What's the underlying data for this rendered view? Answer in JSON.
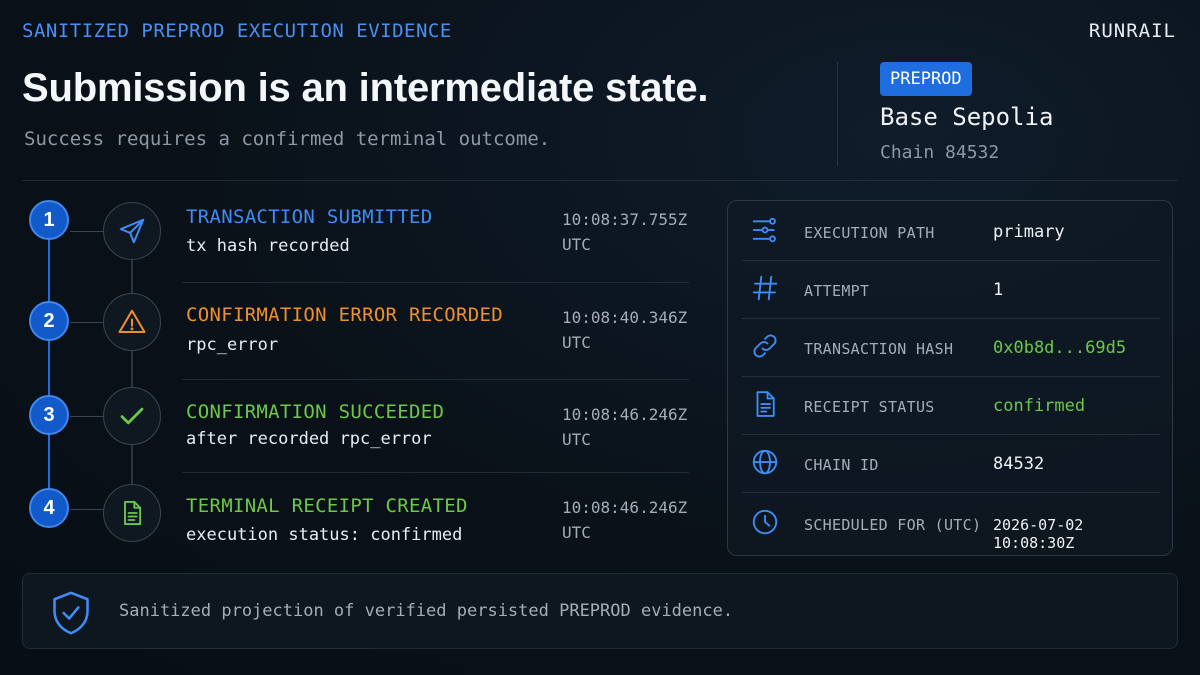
{
  "header": {
    "eyebrow": "SANITIZED PREPROD EXECUTION EVIDENCE",
    "brand": "RUNRAIL",
    "title": "Submission is an intermediate state.",
    "subtitle": "Success requires a confirmed terminal outcome."
  },
  "environment": {
    "badge": "PREPROD",
    "network": "Base Sepolia",
    "chain": "Chain 84532"
  },
  "steps": [
    {
      "number": "1",
      "title": "TRANSACTION SUBMITTED",
      "detail": "tx hash recorded",
      "time": "10:08:37.755Z",
      "tz": "UTC",
      "color": "#3f8cf4",
      "icon": "send-icon"
    },
    {
      "number": "2",
      "title": "CONFIRMATION ERROR RECORDED",
      "detail": "rpc_error",
      "time": "10:08:40.346Z",
      "tz": "UTC",
      "color": "#f0902a",
      "icon": "warning-icon"
    },
    {
      "number": "3",
      "title": "CONFIRMATION SUCCEEDED",
      "detail": "after recorded rpc_error",
      "time": "10:08:46.246Z",
      "tz": "UTC",
      "color": "#6cc84a",
      "icon": "check-icon"
    },
    {
      "number": "4",
      "title": "TERMINAL RECEIPT CREATED",
      "detail": "execution status: confirmed",
      "time": "10:08:46.246Z",
      "tz": "UTC",
      "color": "#6cc84a",
      "icon": "document-icon"
    }
  ],
  "details": [
    {
      "key": "EXECUTION PATH",
      "value": "primary",
      "icon": "path-icon"
    },
    {
      "key": "ATTEMPT",
      "value": "1",
      "icon": "hash-icon"
    },
    {
      "key": "TRANSACTION HASH",
      "value": "0x0b8d...69d5",
      "icon": "link-icon",
      "value_color": "#6cc84a"
    },
    {
      "key": "RECEIPT STATUS",
      "value": "confirmed",
      "icon": "receipt-icon",
      "value_color": "#6cc84a"
    },
    {
      "key": "CHAIN ID",
      "value": "84532",
      "icon": "globe-icon"
    },
    {
      "key": "SCHEDULED FOR (UTC)",
      "value": "2026-07-02 10:08:30Z",
      "icon": "clock-icon"
    }
  ],
  "footer": {
    "text": "Sanitized projection of verified persisted PREPROD evidence.",
    "icon": "shield-check-icon"
  },
  "colors": {
    "accent": "#1e6ee0",
    "warning": "#f0902a",
    "success": "#6cc84a",
    "background": "#0a1119"
  }
}
